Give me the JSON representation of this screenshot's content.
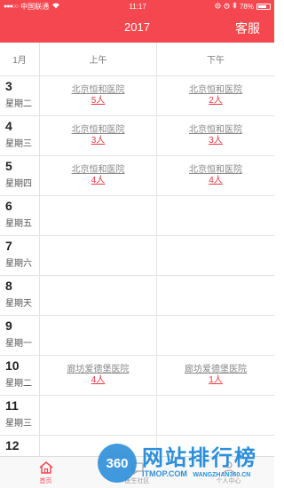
{
  "status_bar": {
    "carrier": "中国联通",
    "time": "11:17",
    "battery": "78%",
    "battery_level": 0.78
  },
  "header": {
    "title": "2017",
    "action_label": "客服"
  },
  "schedule": {
    "month": "1月",
    "morning_label": "上午",
    "afternoon_label": "下午",
    "days": [
      {
        "day": "3",
        "weekday": "星期二",
        "am": {
          "hospital": "北京恒和医院",
          "count": "5人"
        },
        "pm": {
          "hospital": "北京恒和医院",
          "count": "2人"
        }
      },
      {
        "day": "4",
        "weekday": "星期三",
        "am": {
          "hospital": "北京恒和医院",
          "count": "3人"
        },
        "pm": {
          "hospital": "北京恒和医院",
          "count": "3人"
        }
      },
      {
        "day": "5",
        "weekday": "星期四",
        "am": {
          "hospital": "北京恒和医院",
          "count": "4人"
        },
        "pm": {
          "hospital": "北京恒和医院",
          "count": "4人"
        }
      },
      {
        "day": "6",
        "weekday": "星期五",
        "am": {
          "hospital": "",
          "count": ""
        },
        "pm": {
          "hospital": "",
          "count": ""
        }
      },
      {
        "day": "7",
        "weekday": "星期六",
        "am": {
          "hospital": "",
          "count": ""
        },
        "pm": {
          "hospital": "",
          "count": ""
        }
      },
      {
        "day": "8",
        "weekday": "星期天",
        "am": {
          "hospital": "",
          "count": ""
        },
        "pm": {
          "hospital": "",
          "count": ""
        }
      },
      {
        "day": "9",
        "weekday": "星期一",
        "am": {
          "hospital": "",
          "count": ""
        },
        "pm": {
          "hospital": "",
          "count": ""
        }
      },
      {
        "day": "10",
        "weekday": "星期二",
        "am": {
          "hospital": "廊坊爱德堡医院",
          "count": "4人"
        },
        "pm": {
          "hospital": "廊坊爱德堡医院",
          "count": "1人"
        }
      },
      {
        "day": "11",
        "weekday": "星期三",
        "am": {
          "hospital": "",
          "count": ""
        },
        "pm": {
          "hospital": "",
          "count": ""
        }
      },
      {
        "day": "12",
        "weekday": "",
        "am": {
          "hospital": "",
          "count": ""
        },
        "pm": {
          "hospital": "",
          "count": ""
        }
      }
    ]
  },
  "tab_bar": {
    "tabs": [
      {
        "label": "首页",
        "icon": "home-icon",
        "active": true
      },
      {
        "label": "医生社区",
        "icon": "community-icon",
        "active": false
      },
      {
        "label": "个人中心",
        "icon": "person-icon",
        "active": false
      }
    ]
  },
  "watermark": {
    "logo_text": "360",
    "title": "网站排行榜",
    "domain": "ITMOP.COM",
    "sub_domain": "WANGZHAN360.CN"
  },
  "colors": {
    "brand": "#f5474f",
    "count_red": "#e5383f",
    "watermark_blue": "#2d8fd9"
  }
}
